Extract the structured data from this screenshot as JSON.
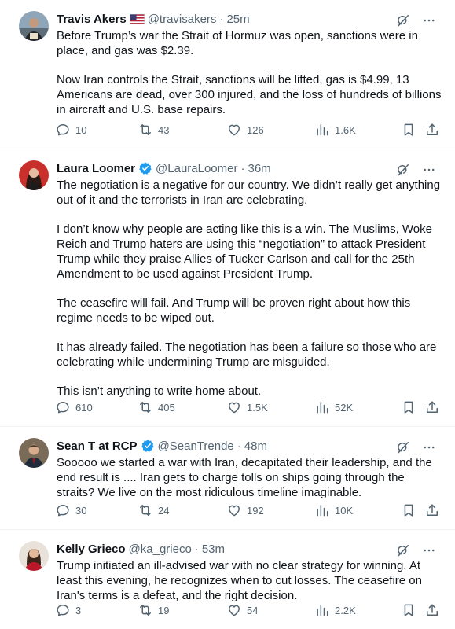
{
  "colors": {
    "text": "#0f1419",
    "secondary": "#536471",
    "verified": "#1d9bf0",
    "divider": "#eff3f4"
  },
  "tweets": [
    {
      "name": "Travis Akers",
      "badge": "us-flag-emoji",
      "handle": "@travisakers",
      "separator": "·",
      "time": "25m",
      "paragraphs": [
        "Before Trump’s war the Strait of Hormuz was open, sanctions were in place, and gas was $2.39.",
        "Now Iran controls the Strait, sanctions will be lifted, gas is $4.99, 13 Americans are dead, over 300 injured, and the loss of hundreds of billions in aircraft and U.S. base repairs."
      ],
      "replies": "10",
      "reposts": "43",
      "likes": "126",
      "views": "1.6K"
    },
    {
      "name": "Laura Loomer",
      "badge": "verified-badge",
      "handle": "@LauraLoomer",
      "separator": "·",
      "time": "36m",
      "paragraphs": [
        "The negotiation is a negative for our country. We didn’t really get anything out of it and the terrorists in Iran are celebrating.",
        "I don’t know why people are acting like this is a win. The Muslims, Woke Reich and Trump haters are using this “negotiation” to attack President Trump while they praise Allies of Tucker Carlson and call for the 25th Amendment to be used against President Trump.",
        "The ceasefire will fail. And Trump will be proven right about how this regime needs to be wiped out.",
        "It has already failed. The negotiation has been a failure so those who are celebrating while undermining Trump are misguided.",
        "This isn’t anything to write home about."
      ],
      "replies": "610",
      "reposts": "405",
      "likes": "1.5K",
      "views": "52K"
    },
    {
      "name": "Sean T at RCP",
      "badge": "verified-badge",
      "handle": "@SeanTrende",
      "separator": "·",
      "time": "48m",
      "paragraphs": [
        "Sooooo we started a war with Iran, decapitated their leadership, and the end result is .... Iran gets to charge tolls on ships going through the straits? We live on the most ridiculous timeline imaginable."
      ],
      "replies": "30",
      "reposts": "24",
      "likes": "192",
      "views": "10K"
    },
    {
      "name": "Kelly Grieco",
      "badge": "",
      "handle": "@ka_grieco",
      "separator": "·",
      "time": "53m",
      "paragraphs": [
        "Trump initiated an ill-advised war with no clear strategy for winning. At least this evening, he recognizes when to cut losses. The ceasefire on Iran's terms is a defeat, and the right decision."
      ],
      "replies": "3",
      "reposts": "19",
      "likes": "54",
      "views": "2.2K"
    }
  ]
}
